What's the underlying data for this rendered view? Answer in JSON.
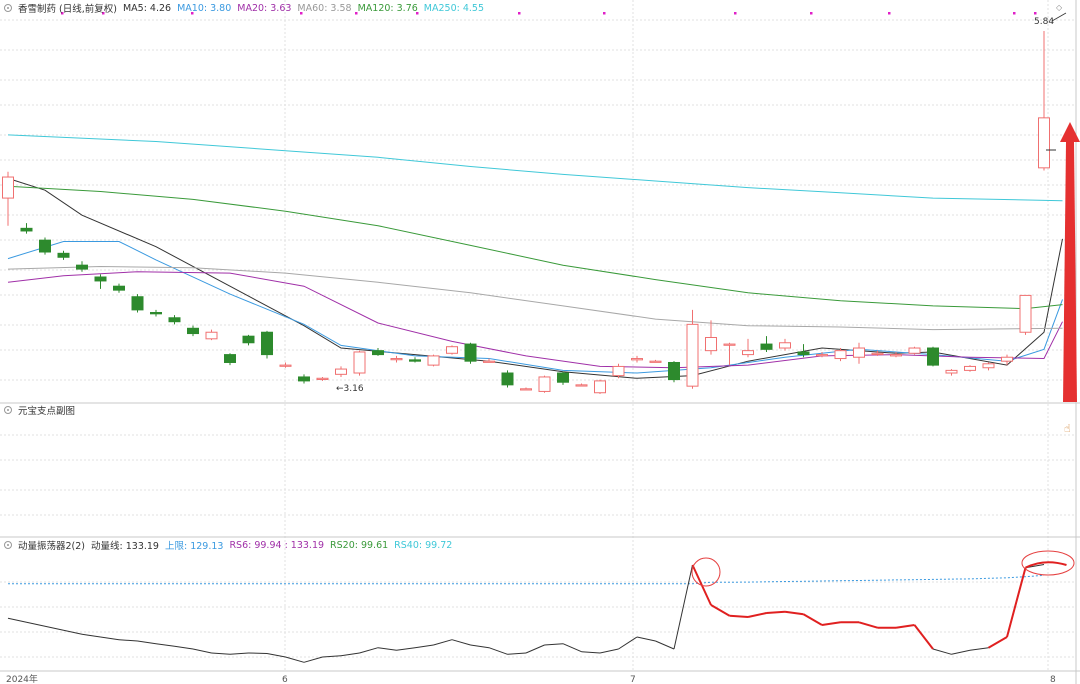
{
  "main_legend": {
    "title": "香雪制药 (日线,前复权)",
    "ma5": "MA5: 4.26",
    "ma10": "MA10: 3.80",
    "ma20": "MA20: 3.63",
    "ma60": "MA60: 3.58",
    "ma120": "MA120: 3.76",
    "ma250": "MA250: 4.55"
  },
  "sub1_legend": {
    "title": "元宝支点副图"
  },
  "sub2_legend": {
    "title": "动量振荡器2(2)",
    "line": "动量线: 133.19",
    "up": "上限: 129.13",
    "rs6": "RS6: 99.94 : 133.19",
    "rs20": "RS20: 99.61",
    "rs40": "RS40: 99.72"
  },
  "annotations": {
    "high": "5.84",
    "low": "←3.16"
  },
  "xaxis": {
    "labels": [
      "2024年",
      "6",
      "7",
      "8"
    ]
  },
  "colors": {
    "up": "#f07070",
    "down": "#2d8a2d",
    "ma5": "#333333",
    "ma10": "#3b9ae0",
    "ma20": "#a030a8",
    "ma60": "#a8a8a8",
    "ma120": "#3a9a3a",
    "ma250": "#40c8d8",
    "arrow": "#e53030",
    "marker": "#e020c8"
  },
  "chart_data": [
    {
      "type": "candlestick",
      "title": "香雪制药 (日线,前复权)",
      "ylim": [
        3.05,
        6.0
      ],
      "annotations": [
        {
          "label": "5.84",
          "point": "high"
        },
        {
          "label": "3.16",
          "point": "low"
        }
      ],
      "candles": [
        [
          4.57,
          4.73,
          4.36,
          4.77
        ],
        [
          4.34,
          4.32,
          4.3,
          4.38
        ],
        [
          4.25,
          4.16,
          4.14,
          4.27
        ],
        [
          4.15,
          4.12,
          4.1,
          4.17
        ],
        [
          4.06,
          4.03,
          4.01,
          4.09
        ],
        [
          3.97,
          3.94,
          3.88,
          3.99
        ],
        [
          3.9,
          3.87,
          3.85,
          3.92
        ],
        [
          3.82,
          3.72,
          3.7,
          3.84
        ],
        [
          3.7,
          3.69,
          3.67,
          3.72
        ],
        [
          3.66,
          3.63,
          3.61,
          3.68
        ],
        [
          3.58,
          3.54,
          3.52,
          3.6
        ],
        [
          3.5,
          3.55,
          3.49,
          3.57
        ],
        [
          3.38,
          3.32,
          3.3,
          3.39
        ],
        [
          3.52,
          3.47,
          3.45,
          3.53
        ],
        [
          3.55,
          3.38,
          3.35,
          3.56
        ],
        [
          3.3,
          3.3,
          3.28,
          3.32
        ],
        [
          3.21,
          3.18,
          3.16,
          3.23
        ],
        [
          3.2,
          3.2,
          3.18,
          3.21
        ],
        [
          3.23,
          3.27,
          3.21,
          3.29
        ],
        [
          3.24,
          3.4,
          3.22,
          3.41
        ],
        [
          3.41,
          3.38,
          3.37,
          3.43
        ],
        [
          3.35,
          3.35,
          3.32,
          3.37
        ],
        [
          3.34,
          3.33,
          3.32,
          3.36
        ],
        [
          3.3,
          3.37,
          3.29,
          3.38
        ],
        [
          3.39,
          3.44,
          3.38,
          3.45
        ],
        [
          3.46,
          3.33,
          3.31,
          3.47
        ],
        [
          3.33,
          3.33,
          3.32,
          3.35
        ],
        [
          3.24,
          3.15,
          3.13,
          3.26
        ],
        [
          3.12,
          3.12,
          3.11,
          3.13
        ],
        [
          3.1,
          3.21,
          3.09,
          3.22
        ],
        [
          3.24,
          3.17,
          3.15,
          3.25
        ],
        [
          3.15,
          3.15,
          3.14,
          3.16
        ],
        [
          3.09,
          3.18,
          3.08,
          3.19
        ],
        [
          3.22,
          3.29,
          3.2,
          3.31
        ],
        [
          3.34,
          3.35,
          3.32,
          3.37
        ],
        [
          3.33,
          3.33,
          3.32,
          3.34
        ],
        [
          3.32,
          3.19,
          3.17,
          3.33
        ],
        [
          3.14,
          3.61,
          3.12,
          3.72
        ],
        [
          3.41,
          3.51,
          3.38,
          3.64
        ],
        [
          3.46,
          3.46,
          3.3,
          3.47
        ],
        [
          3.38,
          3.41,
          3.36,
          3.5
        ],
        [
          3.46,
          3.42,
          3.4,
          3.52
        ],
        [
          3.43,
          3.47,
          3.41,
          3.5
        ],
        [
          3.4,
          3.38,
          3.36,
          3.46
        ],
        [
          3.38,
          3.38,
          3.36,
          3.4
        ],
        [
          3.35,
          3.41,
          3.33,
          3.43
        ],
        [
          3.36,
          3.43,
          3.31,
          3.47
        ],
        [
          3.39,
          3.39,
          3.37,
          3.41
        ],
        [
          3.37,
          3.38,
          3.36,
          3.4
        ],
        [
          3.39,
          3.43,
          3.38,
          3.44
        ],
        [
          3.43,
          3.3,
          3.29,
          3.44
        ],
        [
          3.24,
          3.26,
          3.22,
          3.27
        ],
        [
          3.26,
          3.29,
          3.25,
          3.3
        ],
        [
          3.28,
          3.31,
          3.26,
          3.32
        ],
        [
          3.33,
          3.36,
          3.3,
          3.38
        ],
        [
          3.55,
          3.83,
          3.53,
          3.83
        ],
        [
          4.8,
          5.18,
          4.78,
          5.84
        ]
      ],
      "series": [
        {
          "name": "MA5",
          "points": [
            [
              0,
              4.72
            ],
            [
              2,
              4.63
            ],
            [
              4,
              4.44
            ],
            [
              8,
              4.2
            ],
            [
              12,
              3.9
            ],
            [
              16,
              3.6
            ],
            [
              18,
              3.43
            ],
            [
              22,
              3.38
            ],
            [
              26,
              3.33
            ],
            [
              30,
              3.25
            ],
            [
              34,
              3.2
            ],
            [
              37,
              3.22
            ],
            [
              40,
              3.33
            ],
            [
              44,
              3.43
            ],
            [
              48,
              3.39
            ],
            [
              50,
              3.4
            ],
            [
              54,
              3.3
            ],
            [
              56,
              3.55
            ],
            [
              57,
              4.26
            ]
          ]
        },
        {
          "name": "MA10",
          "points": [
            [
              0,
              4.11
            ],
            [
              3,
              4.24
            ],
            [
              6,
              4.24
            ],
            [
              8,
              4.1
            ],
            [
              12,
              3.84
            ],
            [
              16,
              3.61
            ],
            [
              18,
              3.45
            ],
            [
              22,
              3.37
            ],
            [
              26,
              3.35
            ],
            [
              30,
              3.26
            ],
            [
              34,
              3.24
            ],
            [
              38,
              3.28
            ],
            [
              42,
              3.36
            ],
            [
              46,
              3.42
            ],
            [
              50,
              3.38
            ],
            [
              54,
              3.33
            ],
            [
              56,
              3.42
            ],
            [
              57,
              3.8
            ]
          ]
        },
        {
          "name": "MA20",
          "points": [
            [
              0,
              3.93
            ],
            [
              3,
              3.98
            ],
            [
              7,
              4.01
            ],
            [
              12,
              4.0
            ],
            [
              16,
              3.9
            ],
            [
              20,
              3.62
            ],
            [
              24,
              3.48
            ],
            [
              28,
              3.37
            ],
            [
              32,
              3.29
            ],
            [
              36,
              3.28
            ],
            [
              40,
              3.3
            ],
            [
              44,
              3.37
            ],
            [
              48,
              3.38
            ],
            [
              52,
              3.36
            ],
            [
              56,
              3.35
            ],
            [
              57,
              3.63
            ]
          ]
        },
        {
          "name": "MA60",
          "points": [
            [
              0,
              4.03
            ],
            [
              5,
              4.05
            ],
            [
              10,
              4.04
            ],
            [
              15,
              4.0
            ],
            [
              20,
              3.93
            ],
            [
              25,
              3.85
            ],
            [
              30,
              3.75
            ],
            [
              35,
              3.65
            ],
            [
              40,
              3.6
            ],
            [
              45,
              3.59
            ],
            [
              50,
              3.57
            ],
            [
              57,
              3.58
            ]
          ]
        },
        {
          "name": "MA120",
          "points": [
            [
              0,
              4.66
            ],
            [
              5,
              4.62
            ],
            [
              10,
              4.56
            ],
            [
              15,
              4.47
            ],
            [
              20,
              4.36
            ],
            [
              25,
              4.21
            ],
            [
              30,
              4.06
            ],
            [
              35,
              3.95
            ],
            [
              40,
              3.85
            ],
            [
              45,
              3.79
            ],
            [
              50,
              3.75
            ],
            [
              55,
              3.73
            ],
            [
              57,
              3.76
            ]
          ]
        },
        {
          "name": "MA250",
          "points": [
            [
              0,
              5.05
            ],
            [
              8,
              5.0
            ],
            [
              15,
              4.93
            ],
            [
              20,
              4.88
            ],
            [
              25,
              4.81
            ],
            [
              30,
              4.75
            ],
            [
              35,
              4.7
            ],
            [
              40,
              4.65
            ],
            [
              45,
              4.61
            ],
            [
              50,
              4.57
            ],
            [
              57,
              4.55
            ]
          ]
        }
      ]
    },
    {
      "type": "line",
      "title": "元宝支点副图",
      "series": []
    },
    {
      "type": "line",
      "title": "动量振荡器2(2)",
      "ylim": [
        94,
        136
      ],
      "x_labels": [
        "2024年",
        "6",
        "7",
        "8"
      ],
      "series": [
        {
          "name": "动量线",
          "values": [
            113,
            111.5,
            110,
            108.5,
            107,
            106,
            105,
            104.5,
            103.5,
            102.5,
            101.5,
            100,
            99.5,
            100,
            99.8,
            98.5,
            96.5,
            98.5,
            99,
            100,
            102,
            101,
            102,
            103,
            105,
            103,
            102,
            99.5,
            100,
            103,
            103.5,
            100.5,
            100,
            101.5,
            106,
            104.5,
            101.5,
            133,
            118,
            114,
            113.5,
            115,
            115.5,
            114.5,
            110.5,
            111.5,
            111.5,
            109.5,
            109.5,
            110.5,
            101.5,
            99.5,
            101,
            102,
            106,
            132,
            133.19
          ]
        },
        {
          "name": "上限",
          "values": [
            126,
            126,
            126,
            126,
            126,
            126,
            126,
            126,
            126,
            126,
            126,
            126,
            126,
            126,
            126,
            126,
            126,
            126,
            126,
            126,
            126,
            126,
            126,
            126,
            126,
            126,
            126,
            126,
            126,
            126,
            126,
            126,
            126,
            126,
            126,
            126,
            126,
            126,
            126.5,
            126.5,
            126.6,
            126.7,
            126.8,
            126.9,
            127,
            127.1,
            127.2,
            127.3,
            127.4,
            127.5,
            127.6,
            127.7,
            127.8,
            128,
            128.2,
            128.6,
            129.13
          ]
        }
      ]
    }
  ]
}
